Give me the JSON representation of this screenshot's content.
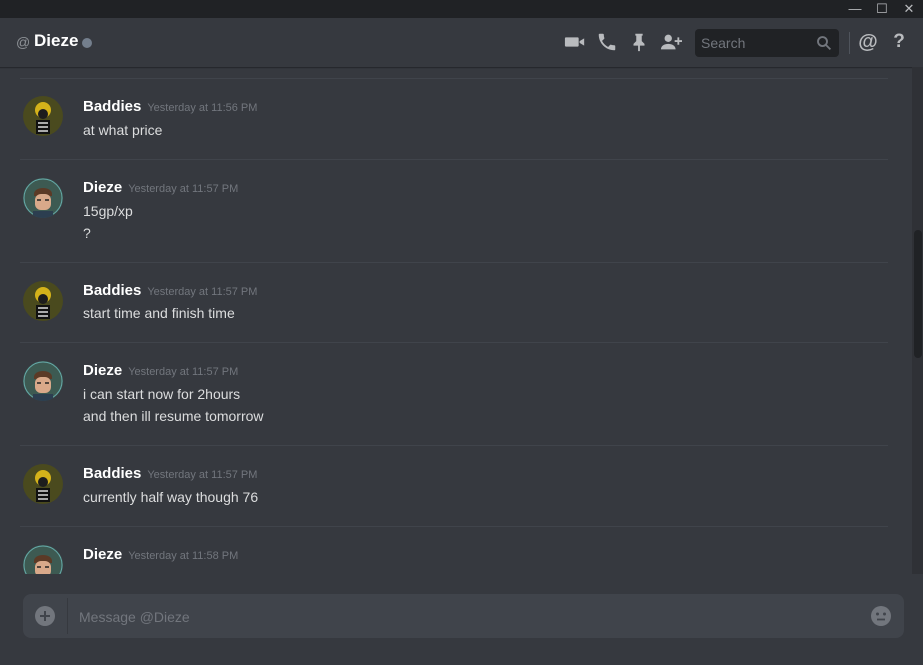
{
  "window": {
    "minimize_glyph": "—",
    "maximize_glyph": "☐",
    "close_glyph": "✕"
  },
  "header": {
    "at_symbol": "@",
    "channel_name": "Dieze",
    "status": "offline",
    "icons": [
      "video-call-icon",
      "voice-call-icon",
      "pin-icon",
      "add-friend-icon",
      "mention-icon",
      "help-icon"
    ],
    "search": {
      "placeholder": "Search"
    },
    "mention_glyph": "@",
    "help_glyph": "?"
  },
  "messages": [
    {
      "author": "Baddies",
      "timestamp": "Yesterday at 11:56 PM",
      "lines": [
        "at what price"
      ]
    },
    {
      "author": "Dieze",
      "timestamp": "Yesterday at 11:57 PM",
      "lines": [
        "15gp/xp",
        "?"
      ]
    },
    {
      "author": "Baddies",
      "timestamp": "Yesterday at 11:57 PM",
      "lines": [
        "start time and finish time"
      ]
    },
    {
      "author": "Dieze",
      "timestamp": "Yesterday at 11:57 PM",
      "lines": [
        "i can start now for 2hours",
        "and then ill resume tomorrow"
      ]
    },
    {
      "author": "Baddies",
      "timestamp": "Yesterday at 11:57 PM",
      "lines": [
        "currently half way though 76"
      ]
    },
    {
      "author": "Dieze",
      "timestamp": "Yesterday at 11:58 PM",
      "lines": []
    }
  ],
  "composer": {
    "placeholder": "Message @Dieze"
  },
  "colors": {
    "background": "#36393f",
    "titlebar": "#202225",
    "input_bg": "#40444b",
    "username": "#ffffff",
    "timestamp": "#72767d",
    "message_text": "#dcddde"
  }
}
